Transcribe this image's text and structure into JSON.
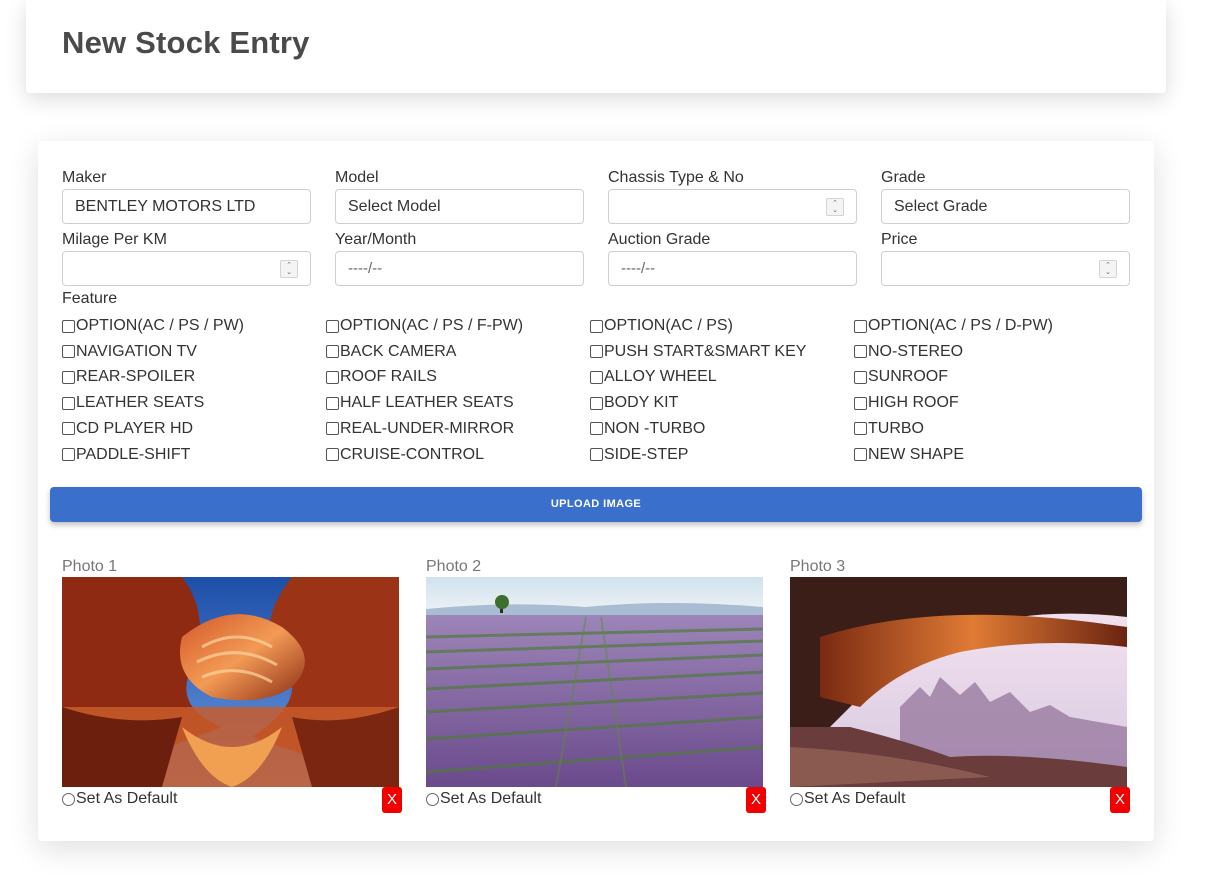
{
  "header": {
    "title": "New Stock Entry"
  },
  "fields": {
    "maker": {
      "label": "Maker",
      "value": "BENTLEY MOTORS LTD"
    },
    "model": {
      "label": "Model",
      "value": "Select Model"
    },
    "chassis": {
      "label": "Chassis Type & No",
      "value": ""
    },
    "grade": {
      "label": "Grade",
      "value": "Select Grade"
    },
    "milage": {
      "label": "Milage Per KM",
      "value": ""
    },
    "year_month": {
      "label": "Year/Month",
      "placeholder": "----/--"
    },
    "auction_grade": {
      "label": "Auction Grade",
      "placeholder": "----/--"
    },
    "price": {
      "label": "Price",
      "value": ""
    }
  },
  "features": {
    "title": "Feature",
    "items": [
      "OPTION(AC / PS / PW)",
      "OPTION(AC / PS / F-PW)",
      "OPTION(AC / PS)",
      "OPTION(AC / PS / D-PW)",
      "NAVIGATION TV",
      "BACK CAMERA",
      "PUSH START&SMART KEY",
      "NO-STEREO",
      "REAR-SPOILER",
      "ROOF RAILS",
      "ALLOY WHEEL",
      "SUNROOF",
      "LEATHER SEATS",
      "HALF LEATHER SEATS",
      "BODY KIT",
      "HIGH ROOF",
      "CD PLAYER HD",
      "REAL-UNDER-MIRROR",
      "NON -TURBO",
      "TURBO",
      "PADDLE-SHIFT",
      "CRUISE-CONTROL",
      "SIDE-STEP",
      "NEW SHAPE"
    ]
  },
  "upload": {
    "label": "UPLOAD IMAGE"
  },
  "photos": [
    {
      "title": "Photo 1",
      "default_label": "Set As Default",
      "delete_label": "X"
    },
    {
      "title": "Photo 2",
      "default_label": "Set As Default",
      "delete_label": "X"
    },
    {
      "title": "Photo 3",
      "default_label": "Set As Default",
      "delete_label": "X"
    }
  ],
  "colors": {
    "primary": "#3a6fcc",
    "danger": "#f20000"
  }
}
